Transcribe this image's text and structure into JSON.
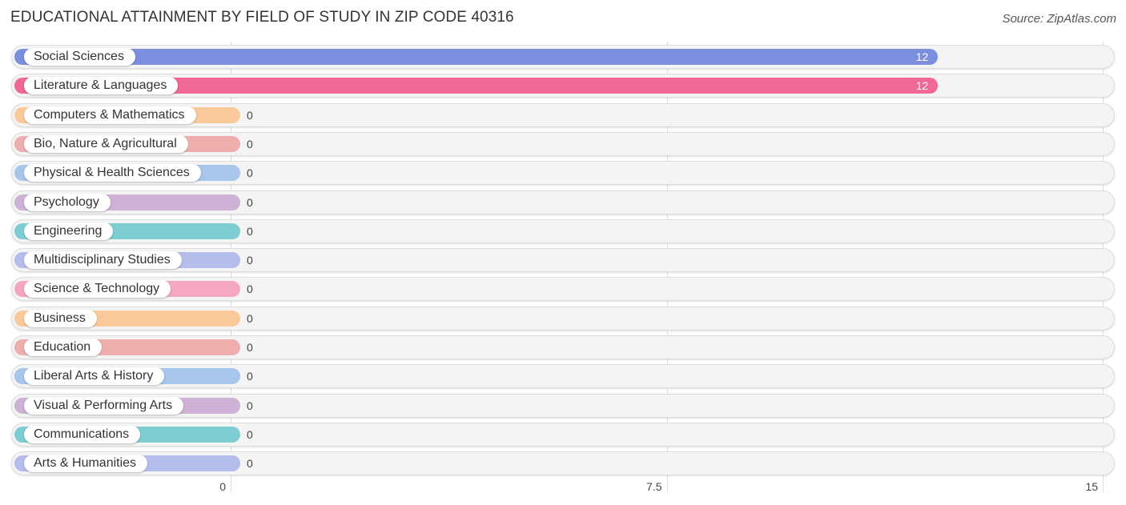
{
  "header": {
    "title": "EDUCATIONAL ATTAINMENT BY FIELD OF STUDY IN ZIP CODE 40316",
    "source": "Source: ZipAtlas.com"
  },
  "chart_data": {
    "type": "bar",
    "orientation": "horizontal",
    "title": "EDUCATIONAL ATTAINMENT BY FIELD OF STUDY IN ZIP CODE 40316",
    "xlabel": "",
    "ylabel": "",
    "xlim": [
      0,
      15
    ],
    "xticks": [
      0,
      7.5,
      15
    ],
    "xtick_labels": [
      "0",
      "7.5",
      "15"
    ],
    "grid": true,
    "categories": [
      "Social Sciences",
      "Literature & Languages",
      "Computers & Mathematics",
      "Bio, Nature & Agricultural",
      "Physical & Health Sciences",
      "Psychology",
      "Engineering",
      "Multidisciplinary Studies",
      "Science & Technology",
      "Business",
      "Education",
      "Liberal Arts & History",
      "Visual & Performing Arts",
      "Communications",
      "Arts & Humanities"
    ],
    "values": [
      12,
      12,
      0,
      0,
      0,
      0,
      0,
      0,
      0,
      0,
      0,
      0,
      0,
      0,
      0
    ],
    "value_labels": [
      "12",
      "12",
      "0",
      "0",
      "0",
      "0",
      "0",
      "0",
      "0",
      "0",
      "0",
      "0",
      "0",
      "0",
      "0"
    ],
    "colors": [
      "#7b8fde",
      "#f06896",
      "#f9c99a",
      "#efaeae",
      "#a8c5ec",
      "#cfb1d6",
      "#7ecdd3",
      "#b5bdea",
      "#f5a7c2",
      "#f9c99a",
      "#efaeae",
      "#a8c5ec",
      "#cfb1d6",
      "#7ecdd3",
      "#b5bdea"
    ]
  }
}
